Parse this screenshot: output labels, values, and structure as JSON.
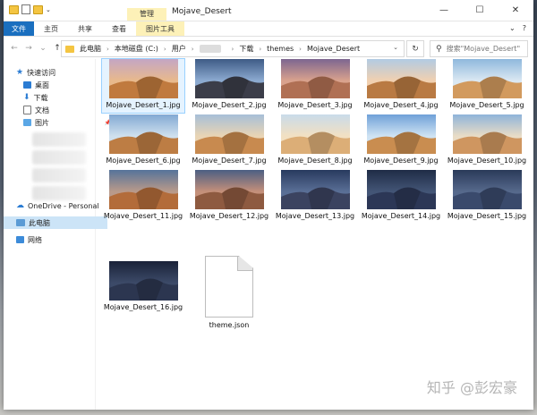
{
  "window": {
    "title": "Mojave_Desert",
    "manage_tab": "管理",
    "controls": [
      "—",
      "☐",
      "✕"
    ]
  },
  "ribbon": {
    "file": "文件",
    "tabs": [
      "主页",
      "共享",
      "查看",
      "图片工具"
    ],
    "right": [
      "⌄",
      "?"
    ]
  },
  "address": {
    "crumbs": [
      "此电脑",
      "本地磁盘 (C:)",
      "用户",
      "",
      "下载",
      "themes",
      "Mojave_Desert"
    ],
    "search_placeholder": "搜索\"Mojave_Desert\""
  },
  "navpane": {
    "quick_access": "快速访问",
    "items": [
      "桌面",
      "下载",
      "文档",
      "图片"
    ],
    "onedrive": "OneDrive - Personal",
    "this_pc": "此电脑",
    "network": "网络"
  },
  "files": [
    "Mojave_Desert_1.jpg",
    "Mojave_Desert_2.jpg",
    "Mojave_Desert_3.jpg",
    "Mojave_Desert_4.jpg",
    "Mojave_Desert_5.jpg",
    "Mojave_Desert_6.jpg",
    "Mojave_Desert_7.jpg",
    "Mojave_Desert_8.jpg",
    "Mojave_Desert_9.jpg",
    "Mojave_Desert_10.jpg",
    "Mojave_Desert_11.jpg",
    "Mojave_Desert_12.jpg",
    "Mojave_Desert_13.jpg",
    "Mojave_Desert_14.jpg",
    "Mojave_Desert_15.jpg",
    "Mojave_Desert_16.jpg",
    "theme.json"
  ],
  "watermark": "知乎 @彭宏豪",
  "colors": {
    "file_tab": "#1a6fbf",
    "manage_tab": "#fdf1b8",
    "selection": "#cce4f7"
  }
}
